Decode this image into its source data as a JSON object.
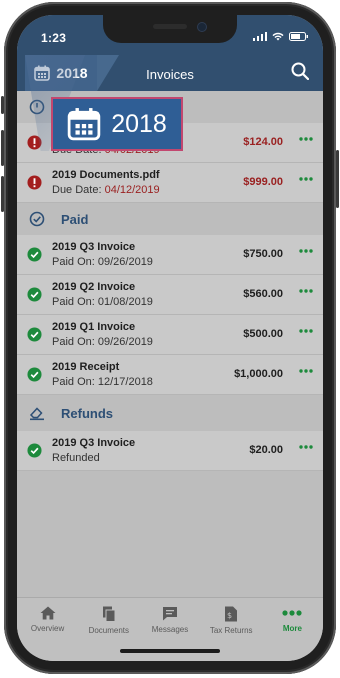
{
  "status_bar": {
    "time": "1:23"
  },
  "app_bar": {
    "year_button_label": "2018",
    "title": "Invoices"
  },
  "year_popup": {
    "label": "2018"
  },
  "sections": [
    {
      "id": "unpaid",
      "rows": [
        {
          "name": "",
          "sub_label": "Due Date:",
          "sub_value": "04/02/2019",
          "amount": "$124.00",
          "status": "overdue"
        },
        {
          "name": "2019 Documents.pdf",
          "sub_label": "Due Date:",
          "sub_value": "04/12/2019",
          "amount": "$999.00",
          "status": "overdue"
        }
      ]
    },
    {
      "id": "paid",
      "title": "Paid",
      "rows": [
        {
          "name": "2019 Q3 Invoice",
          "sub_label": "Paid On:",
          "sub_value": "09/26/2019",
          "amount": "$750.00",
          "status": "paid"
        },
        {
          "name": "2019 Q2 Invoice",
          "sub_label": "Paid On:",
          "sub_value": "01/08/2019",
          "amount": "$560.00",
          "status": "paid"
        },
        {
          "name": "2019 Q1 Invoice",
          "sub_label": "Paid On:",
          "sub_value": "09/26/2019",
          "amount": "$500.00",
          "status": "paid"
        },
        {
          "name": "2019 Receipt",
          "sub_label": "Paid On:",
          "sub_value": "12/17/2018",
          "amount": "$1,000.00",
          "status": "paid"
        }
      ]
    },
    {
      "id": "refunds",
      "title": "Refunds",
      "rows": [
        {
          "name": "2019 Q3 Invoice",
          "sub_label": "Refunded",
          "sub_value": "",
          "amount": "$20.00",
          "status": "paid"
        }
      ]
    }
  ],
  "tab_bar": {
    "tabs": [
      {
        "label": "Overview",
        "icon": "home-icon"
      },
      {
        "label": "Documents",
        "icon": "documents-icon"
      },
      {
        "label": "Messages",
        "icon": "messages-icon"
      },
      {
        "label": "Tax Returns",
        "icon": "tax-returns-icon"
      },
      {
        "label": "More",
        "icon": "more-icon",
        "active": true
      }
    ]
  },
  "colors": {
    "header": "#314f6f",
    "accent_green": "#1d8a3c",
    "alert_red": "#9a2121",
    "popup_border": "#c2476f"
  }
}
